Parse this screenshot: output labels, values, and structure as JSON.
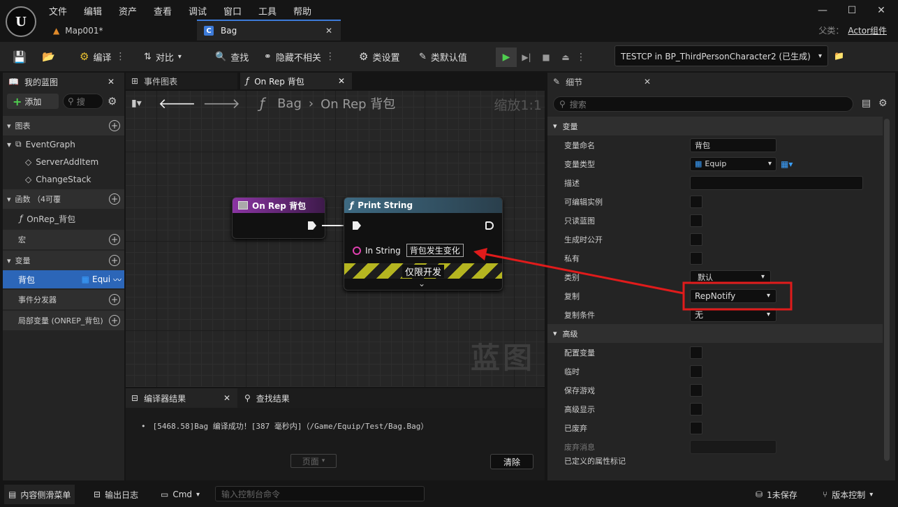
{
  "menu": [
    "文件",
    "编辑",
    "资产",
    "查看",
    "调试",
    "窗口",
    "工具",
    "帮助"
  ],
  "tabs": {
    "map": "Map001*",
    "bag": "Bag"
  },
  "parent_class": {
    "label": "父类：",
    "value": "Actor组件"
  },
  "toolbar": {
    "compile": "编译",
    "diff": "对比",
    "find": "查找",
    "hide_unrelated": "隐藏不相关",
    "class_settings": "类设置",
    "class_defaults": "类默认值",
    "debug_object": "TESTCP in BP_ThirdPersonCharacter2 (已生成)"
  },
  "my_blueprint": {
    "tab": "我的蓝图",
    "add": "添加",
    "search_placeholder": "搜",
    "graphs_section": "图表",
    "event_graph": "EventGraph",
    "events": [
      "ServerAddItem",
      "ChangeStack"
    ],
    "functions_section": "函数 （4可覆",
    "function_item": "OnRep_背包",
    "macros_section": "宏",
    "variables_section": "变量",
    "variable": {
      "name": "背包",
      "type": "Equip"
    },
    "dispatchers_section": "事件分发器",
    "locals_section": "局部变量 (ONREP_背包)"
  },
  "graph": {
    "tab_event_graph": "事件图表",
    "tab_function": "On Rep 背包",
    "breadcrumb_root": "Bag",
    "breadcrumb_current": "On Rep 背包",
    "zoom": "缩放1:1",
    "watermark": "蓝图",
    "node_onrep_title": "On Rep 背包",
    "node_print_title": "Print String",
    "pin_label": "In String",
    "pin_value": "背包发生变化",
    "dev_only": "仅限开发"
  },
  "output": {
    "tab_compiler": "编译器结果",
    "tab_find": "查找结果",
    "log": "[5468.58]Bag 编译成功！[387 毫秒内]（/Game/Equip/Test/Bag.Bag）",
    "page_button": "页面",
    "clear_button": "清除"
  },
  "details": {
    "tab": "细节",
    "search_placeholder": "搜索",
    "section_variable": "变量",
    "section_advanced": "高级",
    "rows": {
      "var_name_label": "变量命名",
      "var_name_value": "背包",
      "var_type_label": "变量类型",
      "var_type_value": "Equip",
      "desc_label": "描述",
      "instance_editable": "可编辑实例",
      "readonly_bp": "只读蓝图",
      "expose_spawn": "生成时公开",
      "private": "私有",
      "category_label": "类别",
      "category_value": "默认",
      "replication_label": "复制",
      "replication_value": "RepNotify",
      "rep_condition_label": "复制条件",
      "rep_condition_value": "无",
      "config_var": "配置变量",
      "transient": "临时",
      "save_game": "保存游戏",
      "advanced_display": "高级显示",
      "deprecated": "已废弃",
      "deprecation_msg": "废弃消息",
      "property_flags": "已定义的属性标记"
    }
  },
  "bottom": {
    "content_drawer": "内容侧滑菜单",
    "output_log": "输出日志",
    "cmd": "Cmd",
    "console_placeholder": "输入控制台命令",
    "unsaved": "1未保存",
    "source_control": "版本控制"
  },
  "colors": {
    "accent": "#3d7bd9",
    "annotation": "#e01b1b",
    "function_node": "#7a2b8e",
    "print_node": "#3c5f74",
    "selection": "#2c66b8"
  }
}
